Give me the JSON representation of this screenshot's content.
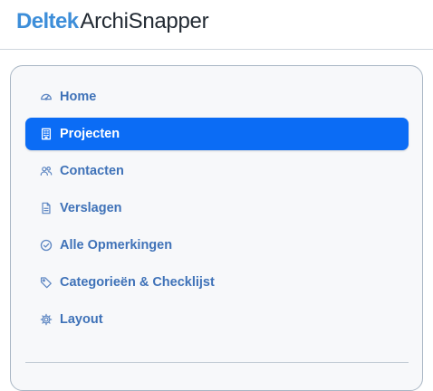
{
  "app": {
    "brand": "Deltek",
    "product": "ArchiSnapper"
  },
  "colors": {
    "brand_blue": "#3d8ed9",
    "product_text": "#222a33",
    "nav_text": "#3f72b8",
    "nav_icon": "#5d86c2",
    "active_bg": "#0b6cf5",
    "active_text": "#ffffff"
  },
  "sidebar": {
    "items": [
      {
        "label": "Home",
        "icon": "dashboard-gauge-icon",
        "active": false
      },
      {
        "label": "Projecten",
        "icon": "building-icon",
        "active": true
      },
      {
        "label": "Contacten",
        "icon": "users-icon",
        "active": false
      },
      {
        "label": "Verslagen",
        "icon": "document-icon",
        "active": false
      },
      {
        "label": "Alle Opmerkingen",
        "icon": "check-circle-icon",
        "active": false
      },
      {
        "label": "Categorieën & Checklijst",
        "icon": "tag-icon",
        "active": false
      },
      {
        "label": "Layout",
        "icon": "gear-icon",
        "active": false
      }
    ]
  }
}
